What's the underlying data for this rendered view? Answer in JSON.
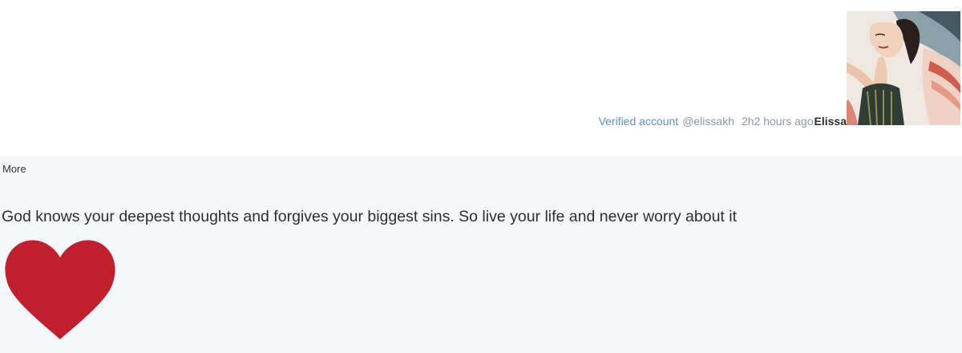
{
  "tweet": {
    "verified_label": "Verified account",
    "handle": "@elissakh",
    "time": "2h2 hours ago",
    "name": "Elissa",
    "more_label": "More",
    "text": "God knows your deepest thoughts and forgives your biggest sins. So live your life and never worry about it"
  },
  "colors": {
    "verified_link": "#5f8fc4",
    "meta_gray": "#8899a6",
    "body_background": "#f5f8fa",
    "heart": "#c0202e"
  },
  "icons": {
    "heart": "heart-emoji-icon",
    "avatar": "profile-avatar"
  }
}
